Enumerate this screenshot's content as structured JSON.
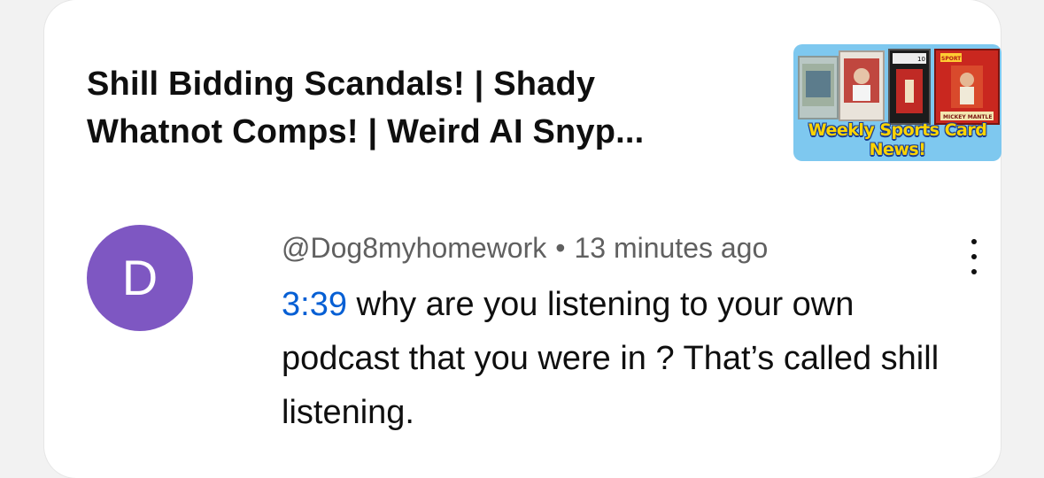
{
  "video": {
    "title": "Shill Bidding Scandals! | Shady Whatnot Comps! | Weird AI Snyp...",
    "thumbnail_caption": "Weekly Sports Card News!",
    "thumbnail_card_labels": [
      "SPORT",
      "MICKEY MANTLE",
      "10"
    ]
  },
  "comment": {
    "avatar_letter": "D",
    "avatar_color": "#7e57c2",
    "author": "@Dog8myhomework",
    "separator": "•",
    "time": "13 minutes ago",
    "timestamp_link": "3:39",
    "body": " why are you listening to your own podcast that you were in ? That’s called shill listening.",
    "more_icon": "more-vert-icon"
  }
}
